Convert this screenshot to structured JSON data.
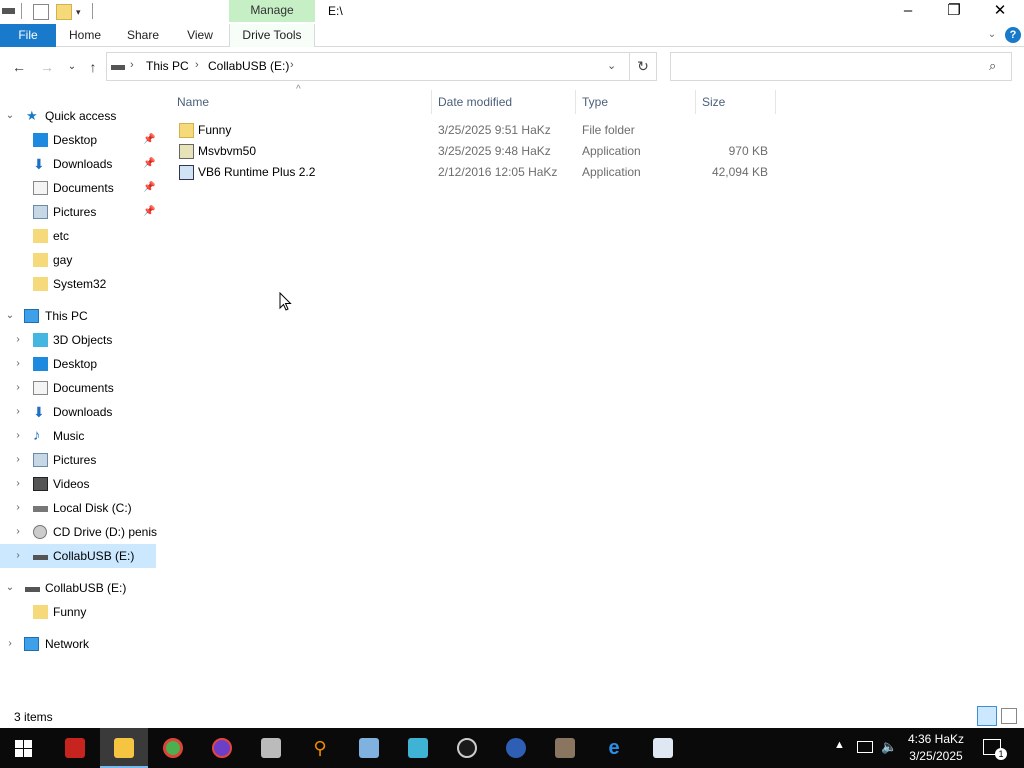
{
  "window": {
    "title": "E:\\",
    "manage_tab": "Manage"
  },
  "ribbon": {
    "tabs": [
      "File",
      "Home",
      "Share",
      "View",
      "Drive Tools"
    ]
  },
  "address": {
    "crumbs": [
      "This PC",
      "CollabUSB (E:)"
    ]
  },
  "nav": {
    "quick_access": {
      "label": "Quick access",
      "items": [
        "Desktop",
        "Downloads",
        "Documents",
        "Pictures",
        "etc",
        "gay",
        "System32"
      ]
    },
    "this_pc": {
      "label": "This PC",
      "items": [
        "3D Objects",
        "Desktop",
        "Documents",
        "Downloads",
        "Music",
        "Pictures",
        "Videos",
        "Local Disk (C:)",
        "CD Drive (D:) penis",
        "CollabUSB (E:)"
      ]
    },
    "usb": {
      "label": "CollabUSB (E:)",
      "items": [
        "Funny"
      ]
    },
    "network": "Network"
  },
  "columns": [
    "Name",
    "Date modified",
    "Type",
    "Size"
  ],
  "files": [
    {
      "name": "Funny",
      "date": "3/25/2025 9:51 HaKz",
      "type": "File folder",
      "size": ""
    },
    {
      "name": "Msvbvm50",
      "date": "3/25/2025 9:48 HaKz",
      "type": "Application",
      "size": "970 KB"
    },
    {
      "name": "VB6 Runtime Plus 2.2",
      "date": "2/12/2016 12:05 HaKz",
      "type": "Application",
      "size": "42,094 KB"
    }
  ],
  "status": "3 items",
  "taskbar": {
    "time": "4:36 HaKz",
    "date": "3/25/2025",
    "notification_count": "1"
  },
  "colors": {
    "accent": "#1979ca",
    "selection": "#cce8ff",
    "manage": "#c6efc6",
    "taskbar": "#0a0a0a"
  }
}
